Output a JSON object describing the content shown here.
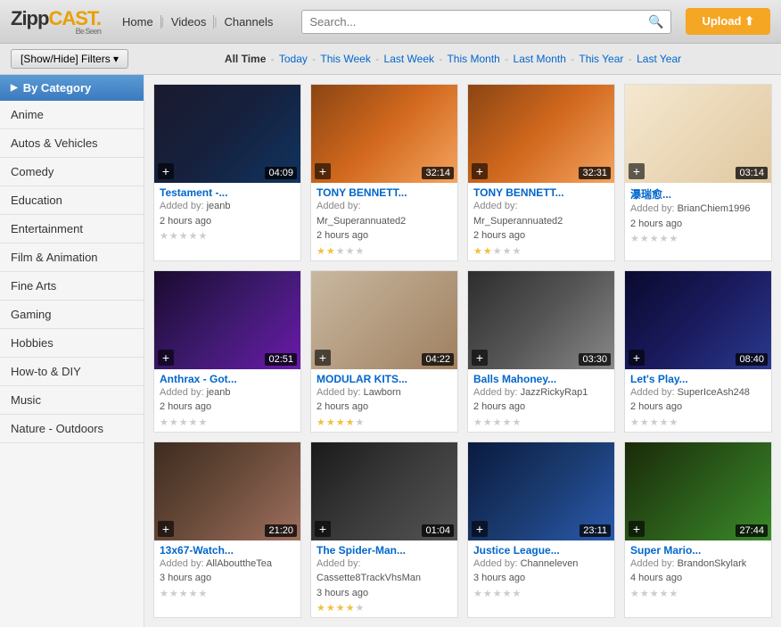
{
  "header": {
    "logo_zip": "Zipp",
    "logo_cast": "CAST",
    "tagline": "Be Seen",
    "nav_items": [
      "Home",
      "Videos",
      "Channels"
    ],
    "search_placeholder": "Search...",
    "upload_label": "Upload ⬆"
  },
  "subheader": {
    "filter_label": "[Show/Hide] Filters ▾",
    "time_filters": [
      {
        "label": "All Time",
        "active": true
      },
      {
        "label": "Today",
        "active": false
      },
      {
        "label": "This Week",
        "active": false
      },
      {
        "label": "Last Week",
        "active": false
      },
      {
        "label": "This Month",
        "active": false
      },
      {
        "label": "Last Month",
        "active": false
      },
      {
        "label": "This Year",
        "active": false
      },
      {
        "label": "Last Year",
        "active": false
      }
    ]
  },
  "sidebar": {
    "header": "By Category",
    "items": [
      "Anime",
      "Autos & Vehicles",
      "Comedy",
      "Education",
      "Entertainment",
      "Film & Animation",
      "Fine Arts",
      "Gaming",
      "Hobbies",
      "How-to & DIY",
      "Music",
      "Nature - Outdoors"
    ]
  },
  "videos": [
    {
      "title": "Testament -...",
      "added_by": "jeanb",
      "time_ago": "2 hours ago",
      "duration": "04:09",
      "stars": 0,
      "thumb_class": "thumb-dark"
    },
    {
      "title": "TONY BENNETT...",
      "added_by": "Mr_Superannuated2",
      "time_ago": "2 hours ago",
      "duration": "32:14",
      "stars": 2,
      "thumb_class": "thumb-warm"
    },
    {
      "title": "TONY BENNETT...",
      "added_by": "Mr_Superannuated2",
      "time_ago": "2 hours ago",
      "duration": "32:31",
      "stars": 2,
      "thumb_class": "thumb-warm"
    },
    {
      "title": "瀑瑞愈...",
      "added_by": "BrianChiem1996",
      "time_ago": "2 hours ago",
      "duration": "03:14",
      "stars": 0,
      "thumb_class": "thumb-japanese"
    },
    {
      "title": "Anthrax - Got...",
      "added_by": "jeanb",
      "time_ago": "2 hours ago",
      "duration": "02:51",
      "stars": 0,
      "thumb_class": "thumb-concert"
    },
    {
      "title": "MODULAR KITS...",
      "added_by": "Lawborn",
      "time_ago": "2 hours ago",
      "duration": "04:22",
      "stars": 4,
      "thumb_class": "thumb-kitchen"
    },
    {
      "title": "Balls Mahoney...",
      "added_by": "JazzRickyRap1",
      "time_ago": "2 hours ago",
      "duration": "03:30",
      "stars": 0,
      "thumb_class": "thumb-wrestling"
    },
    {
      "title": "Let's Play...",
      "added_by": "SuperIceAsh248",
      "time_ago": "2 hours ago",
      "duration": "08:40",
      "stars": 0,
      "thumb_class": "thumb-game"
    },
    {
      "title": "13x67-Watch...",
      "added_by": "AllAbouttheTea",
      "time_ago": "3 hours ago",
      "duration": "21:20",
      "stars": 0,
      "thumb_class": "thumb-people"
    },
    {
      "title": "The Spider-Man...",
      "added_by": "Cassette8TrackVhsMan",
      "time_ago": "3 hours ago",
      "duration": "01:04",
      "stars": 4,
      "thumb_class": "thumb-charles"
    },
    {
      "title": "Justice League...",
      "added_by": "Channeleven",
      "time_ago": "3 hours ago",
      "duration": "23:11",
      "stars": 0,
      "thumb_class": "thumb-justice"
    },
    {
      "title": "Super Mario...",
      "added_by": "BrandonSkylark",
      "time_ago": "4 hours ago",
      "duration": "27:44",
      "stars": 0,
      "thumb_class": "thumb-mario"
    }
  ]
}
